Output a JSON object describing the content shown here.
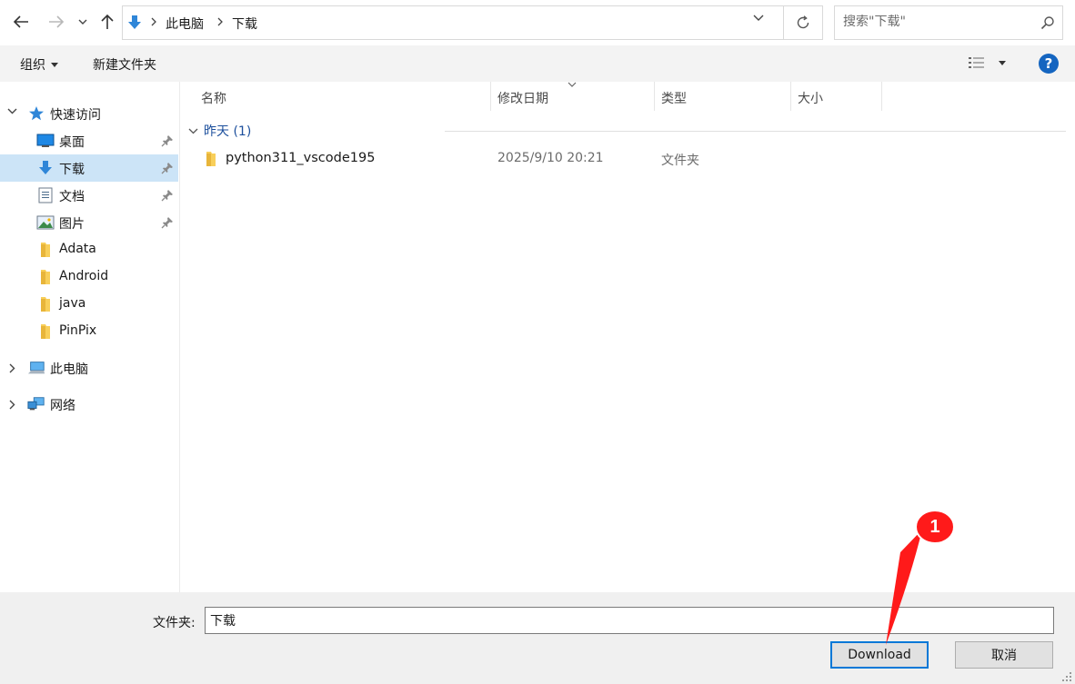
{
  "address": {
    "crumbs": [
      "此电脑",
      "下载"
    ]
  },
  "search": {
    "placeholder": "搜索\"下载\""
  },
  "toolbar": {
    "organize_label": "组织",
    "new_folder_label": "新建文件夹"
  },
  "sidebar": {
    "quick_access": "快速访问",
    "items": [
      {
        "label": "桌面",
        "icon": "desktop-icon",
        "pinned": true
      },
      {
        "label": "下载",
        "icon": "download-icon",
        "pinned": true,
        "selected": true
      },
      {
        "label": "文档",
        "icon": "document-icon",
        "pinned": true
      },
      {
        "label": "图片",
        "icon": "picture-icon",
        "pinned": true
      },
      {
        "label": "Adata",
        "icon": "folder-icon",
        "pinned": false
      },
      {
        "label": "Android",
        "icon": "folder-icon",
        "pinned": false
      },
      {
        "label": "java",
        "icon": "folder-icon",
        "pinned": false
      },
      {
        "label": "PinPix",
        "icon": "folder-icon",
        "pinned": false
      }
    ],
    "this_pc": "此电脑",
    "network": "网络"
  },
  "filelist": {
    "columns": [
      "名称",
      "修改日期",
      "类型",
      "大小"
    ],
    "group": {
      "label": "昨天 (1)"
    },
    "rows": [
      {
        "name": "python311_vscode195",
        "date": "2025/9/10 20:21",
        "type": "文件夹",
        "size": ""
      }
    ]
  },
  "bottom": {
    "folder_label": "文件夹:",
    "folder_value": "下载",
    "primary_label": "Download",
    "cancel_label": "取消"
  },
  "annotation": {
    "badge_number": "1",
    "color": "#ff1a1a"
  },
  "colors": {
    "accent": "#0078d7",
    "selected_bg": "#cce4f7",
    "group_text": "#1c4f9c"
  }
}
